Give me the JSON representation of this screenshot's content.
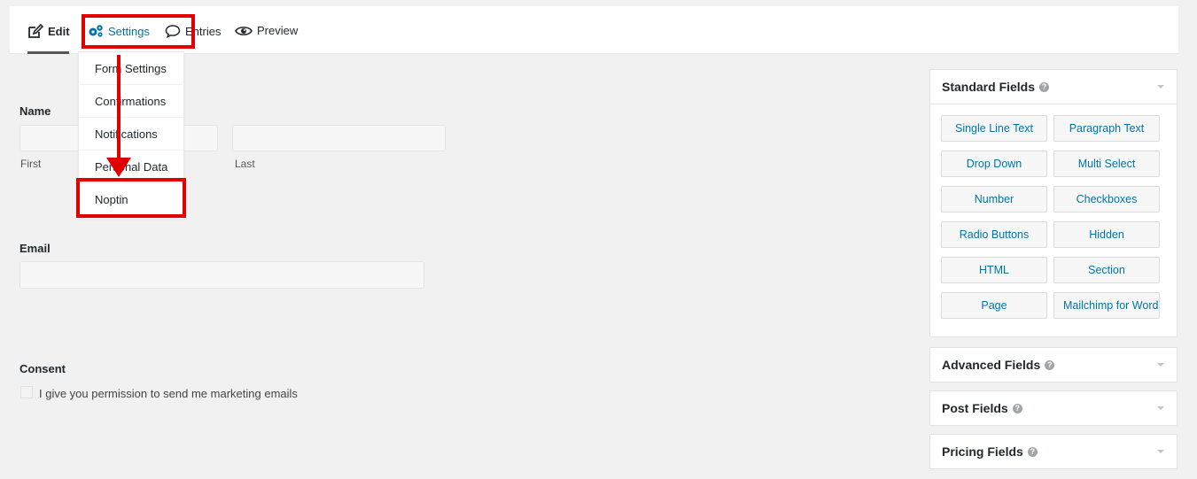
{
  "toolbar": {
    "tabs": {
      "edit": "Edit",
      "settings": "Settings",
      "entries": "Entries",
      "preview": "Preview"
    }
  },
  "settings_menu": {
    "items": [
      "Form Settings",
      "Confirmations",
      "Notifications",
      "Personal Data",
      "Noptin"
    ]
  },
  "form": {
    "name_label": "Name",
    "first_sublabel": "First",
    "last_sublabel": "Last",
    "email_label": "Email",
    "consent_label": "Consent",
    "consent_text": "I give you permission to send me marketing emails"
  },
  "sidebar": {
    "standard": {
      "title": "Standard Fields",
      "buttons": [
        "Single Line Text",
        "Paragraph Text",
        "Drop Down",
        "Multi Select",
        "Number",
        "Checkboxes",
        "Radio Buttons",
        "Hidden",
        "HTML",
        "Section",
        "Page",
        "Mailchimp for WordPress"
      ]
    },
    "advanced": {
      "title": "Advanced Fields"
    },
    "post": {
      "title": "Post Fields"
    },
    "pricing": {
      "title": "Pricing Fields"
    }
  },
  "colors": {
    "accent": "#0073aa",
    "annotation": "#e00000"
  }
}
